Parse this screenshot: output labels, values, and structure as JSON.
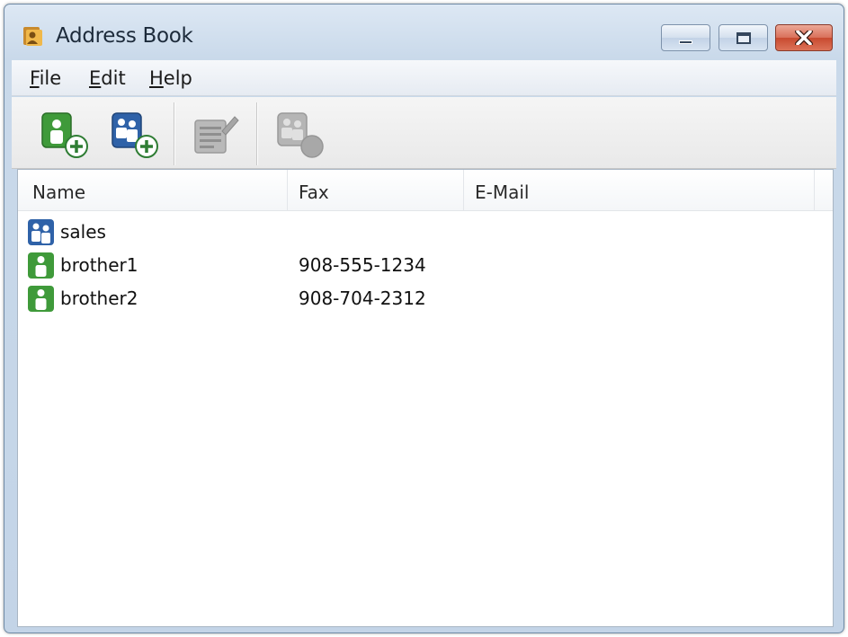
{
  "window": {
    "title": "Address Book"
  },
  "menubar": {
    "file": {
      "underline": "F",
      "rest": "ile"
    },
    "edit": {
      "underline": "E",
      "rest": "dit"
    },
    "help": {
      "underline": "H",
      "rest": "elp"
    }
  },
  "toolbar": {
    "icons": [
      "add-member-icon",
      "add-group-icon",
      "edit-icon",
      "delete-icon"
    ]
  },
  "list": {
    "columns": {
      "name": "Name",
      "fax": "Fax",
      "email": "E-Mail"
    },
    "rows": [
      {
        "type": "group",
        "name": "sales",
        "fax": "",
        "email": ""
      },
      {
        "type": "member",
        "name": "brother1",
        "fax": "908-555-1234",
        "email": ""
      },
      {
        "type": "member",
        "name": "brother2",
        "fax": "908-704-2312",
        "email": ""
      }
    ]
  },
  "colors": {
    "member_green": "#3f9a3a",
    "group_blue": "#2f62a8",
    "close_red": "#c84a30"
  }
}
